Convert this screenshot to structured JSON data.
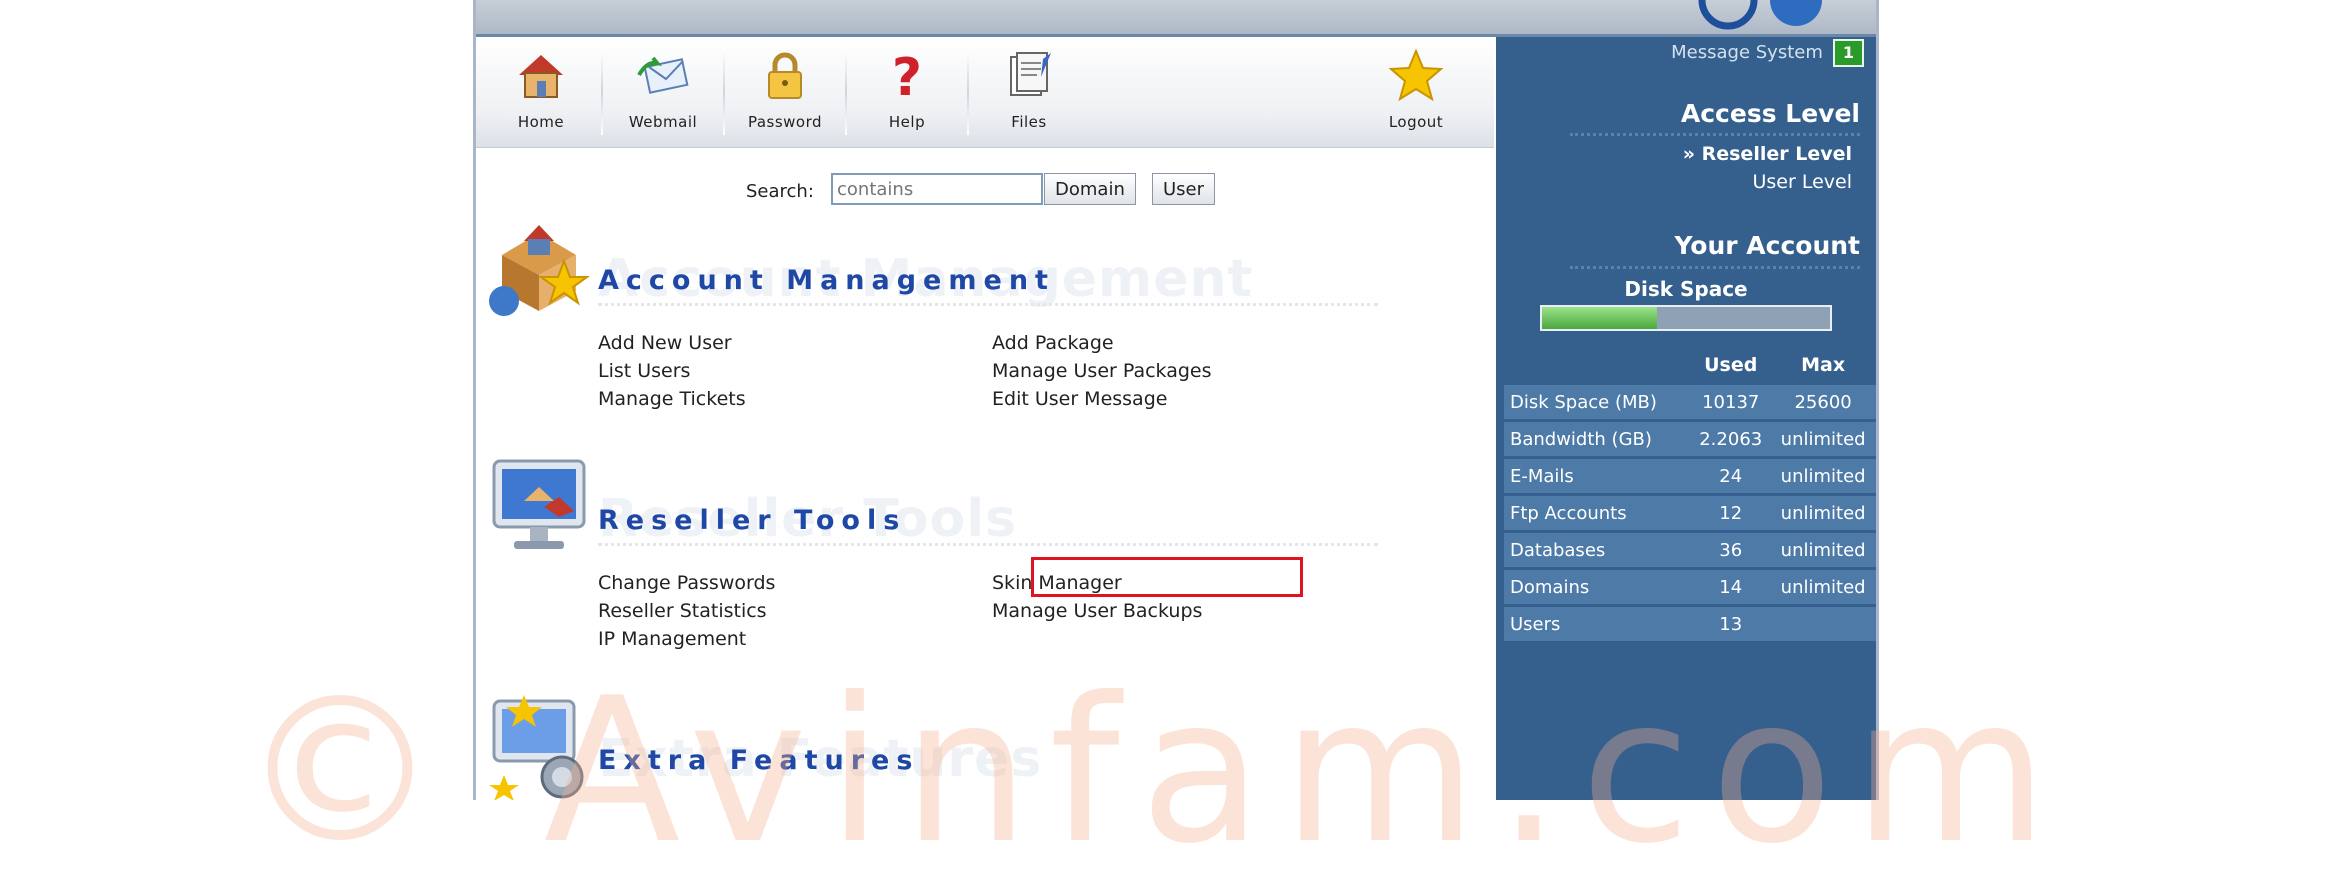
{
  "toolbar": {
    "items": [
      {
        "label": "Home",
        "icon": "home-icon"
      },
      {
        "label": "Webmail",
        "icon": "webmail-icon"
      },
      {
        "label": "Password",
        "icon": "lock-icon"
      },
      {
        "label": "Help",
        "icon": "help-icon"
      },
      {
        "label": "Files",
        "icon": "files-icon"
      },
      {
        "label": "Logout",
        "icon": "star-icon"
      }
    ]
  },
  "search": {
    "label": "Search:",
    "placeholder": "contains",
    "domain_button": "Domain",
    "user_button": "User"
  },
  "sections": {
    "account": {
      "title": "Account Management",
      "icon": "account-management-icon",
      "left_links": [
        "Add New User",
        "List Users",
        "Manage Tickets"
      ],
      "right_links": [
        "Add Package",
        "Manage User Packages",
        "Edit User Message"
      ]
    },
    "reseller": {
      "title": "Reseller Tools",
      "icon": "reseller-tools-icon",
      "left_links": [
        "Change Passwords",
        "Reseller Statistics",
        "IP Management"
      ],
      "right_links": [
        "Skin Manager",
        "Manage User Backups"
      ]
    },
    "extra": {
      "title": "Extra Features",
      "icon": "extra-features-icon"
    }
  },
  "sidebar": {
    "message_label": "Message System",
    "message_count": "1",
    "access_heading": "Access Level",
    "levels": [
      "» Reseller Level",
      "User Level"
    ],
    "account_heading": "Your Account",
    "disk_label": "Disk Space",
    "disk_usage_fraction": 0.4,
    "columns": [
      "Used",
      "Max"
    ],
    "rows": [
      {
        "name": "Disk Space (MB)",
        "used": "10137",
        "max": "25600"
      },
      {
        "name": "Bandwidth (GB)",
        "used": "2.2063",
        "max": "unlimited"
      },
      {
        "name": "E-Mails",
        "used": "24",
        "max": "unlimited"
      },
      {
        "name": "Ftp Accounts",
        "used": "12",
        "max": "unlimited"
      },
      {
        "name": "Databases",
        "used": "36",
        "max": "unlimited"
      },
      {
        "name": "Domains",
        "used": "14",
        "max": "unlimited"
      },
      {
        "name": "Users",
        "used": "13",
        "max": ""
      }
    ]
  },
  "watermark": "© Avinfam.com",
  "colors": {
    "sidebar_bg": "#35608e",
    "section_title": "#1f47a6",
    "highlight": "#e0141e"
  }
}
